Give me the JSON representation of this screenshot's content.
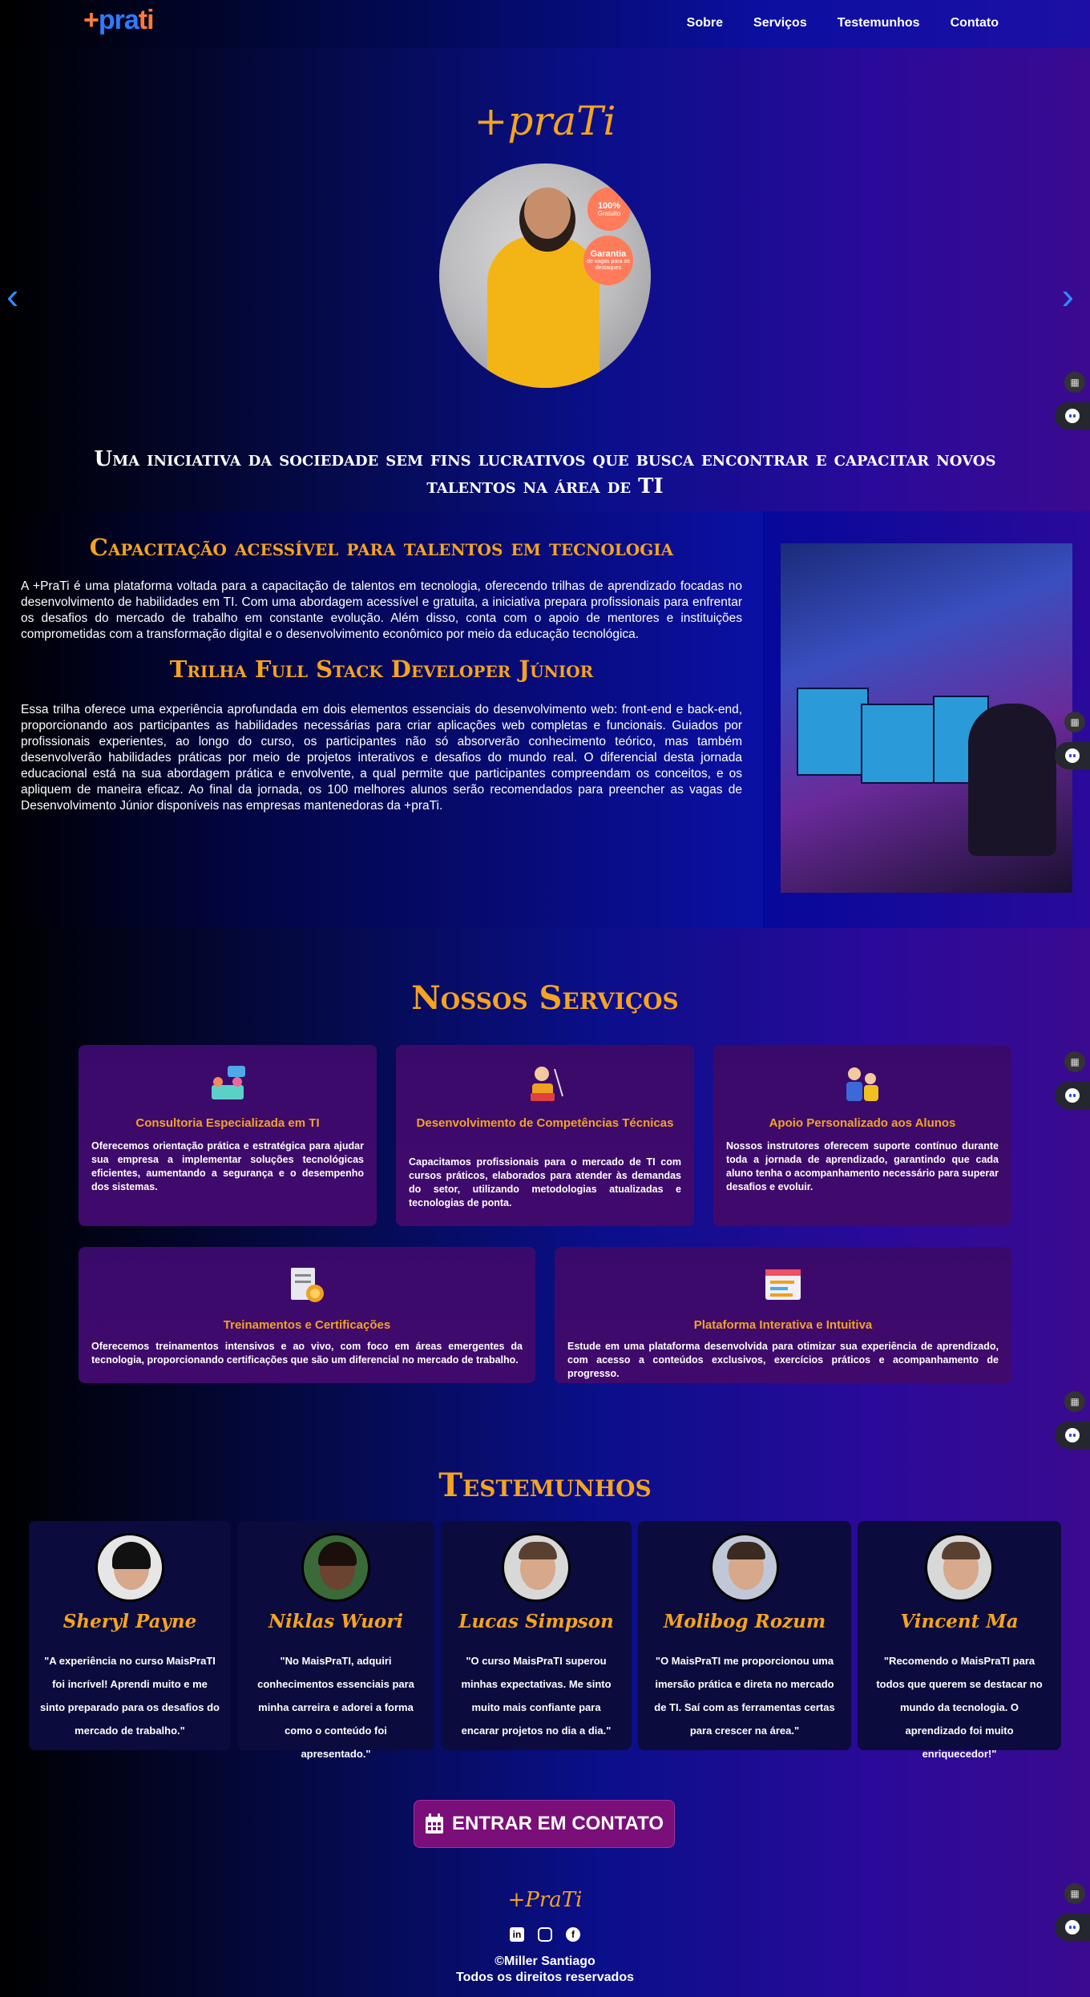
{
  "header": {
    "logo_plus": "+",
    "logo_pra": "pra",
    "logo_ti": "ti",
    "nav": [
      "Sobre",
      "Serviços",
      "Testemunhos",
      "Contato"
    ]
  },
  "hero": {
    "title": "+praTi",
    "badge1_num": "100%",
    "badge1_text": "Gratuito",
    "badge2_title": "Garantia",
    "badge2_text": "de vagas para os destaques",
    "subtitle": "Uma iniciativa da sociedade sem fins lucrativos que busca encontrar e capacitar novos talentos na área de TI",
    "prev_arrow": "‹",
    "next_arrow": "›"
  },
  "about": {
    "title1": "Capacitação acessível para talentos em tecnologia",
    "text1": "A +PraTi é uma plataforma voltada para a capacitação de talentos em tecnologia, oferecendo trilhas de aprendizado focadas no desenvolvimento de habilidades em TI. Com uma abordagem acessível e gratuita, a iniciativa prepara profissionais para enfrentar os desafios do mercado de trabalho em constante evolução. Além disso, conta com o apoio de mentores e instituições comprometidas com a transformação digital e o desenvolvimento econômico por meio da educação tecnológica.",
    "title2": "Trilha Full Stack Developer Júnior",
    "text2": "Essa trilha oferece uma experiência aprofundada em dois elementos essenciais do desenvolvimento web: front-end e back-end, proporcionando aos participantes as habilidades necessárias para criar aplicações web completas e funcionais. Guiados por profissionais experientes, ao longo do curso, os participantes não só absorverão conhecimento teórico, mas também desenvolverão habilidades práticas por meio de projetos interativos e desafios do mundo real. O diferencial desta jornada educacional está na sua abordagem prática e envolvente, a qual permite que participantes compreendam os conceitos, e os apliquem de maneira eficaz. Ao final da jornada, os 100 melhores alunos serão recomendados para preencher as vagas de Desenvolvimento Júnior disponíveis nas empresas mantenedoras da +praTi."
  },
  "services": {
    "title": "Nossos Serviços",
    "cards": [
      {
        "title": "Consultoria Especializada em TI",
        "text": "Oferecemos orientação prática e estratégica para ajudar sua empresa a implementar soluções tecnológicas eficientes, aumentando a segurança e o desempenho dos sistemas."
      },
      {
        "title": "Desenvolvimento de Competências Técnicas",
        "text": "Capacitamos profissionais para o mercado de TI com cursos práticos, elaborados para atender às demandas do setor, utilizando metodologias atualizadas e tecnologias de ponta."
      },
      {
        "title": "Apoio Personalizado aos Alunos",
        "text": "Nossos instrutores oferecem suporte contínuo durante toda a jornada de aprendizado, garantindo que cada aluno tenha o acompanhamento necessário para superar desafios e evoluir."
      },
      {
        "title": "Treinamentos e Certificações",
        "text": "Oferecemos treinamentos intensivos e ao vivo, com foco em áreas emergentes da tecnologia, proporcionando certificações que são um diferencial no mercado de trabalho."
      },
      {
        "title": "Plataforma Interativa e Intuitiva",
        "text": "Estude em uma plataforma desenvolvida para otimizar sua experiência de aprendizado, com acesso a conteúdos exclusivos, exercícios práticos e acompanhamento de progresso."
      }
    ]
  },
  "testimonials": {
    "title": "Testemunhos",
    "items": [
      {
        "name": "Sheryl Payne",
        "text": "\"A experiência no curso MaisPraTI foi incrível! Aprendi muito e me sinto preparado para os desafios do mercado de trabalho.\""
      },
      {
        "name": "Niklas Wuori",
        "text": "\"No MaisPraTI, adquiri conhecimentos essenciais para minha carreira e adorei a forma como o conteúdo foi apresentado.\""
      },
      {
        "name": "Lucas Simpson",
        "text": "\"O curso MaisPraTI superou minhas expectativas. Me sinto muito mais confiante para encarar projetos no dia a dia.\""
      },
      {
        "name": "Molibog Rozum",
        "text": "\"O MaisPraTI me proporcionou uma imersão prática e direta no mercado de TI. Saí com as ferramentas certas para crescer na área.\""
      },
      {
        "name": "Vincent Ma",
        "text": "\"Recomendo o MaisPraTI para todos que querem se destacar no mundo da tecnologia. O aprendizado foi muito enriquecedor!\""
      }
    ]
  },
  "contact": {
    "button_label": "ENTRAR EM CONTATO"
  },
  "footer": {
    "brand": "+PraTi",
    "copyright": "©Miller Santiago",
    "rights": "Todos os direitos reservados"
  },
  "icons": {
    "calendar": "calendar-icon",
    "linkedin": "linkedin-icon",
    "instagram": "instagram-icon",
    "facebook": "facebook-icon"
  },
  "colors": {
    "accent": "#f5a320",
    "link_blue": "#2f8bff",
    "button": "#7a0f7a"
  }
}
